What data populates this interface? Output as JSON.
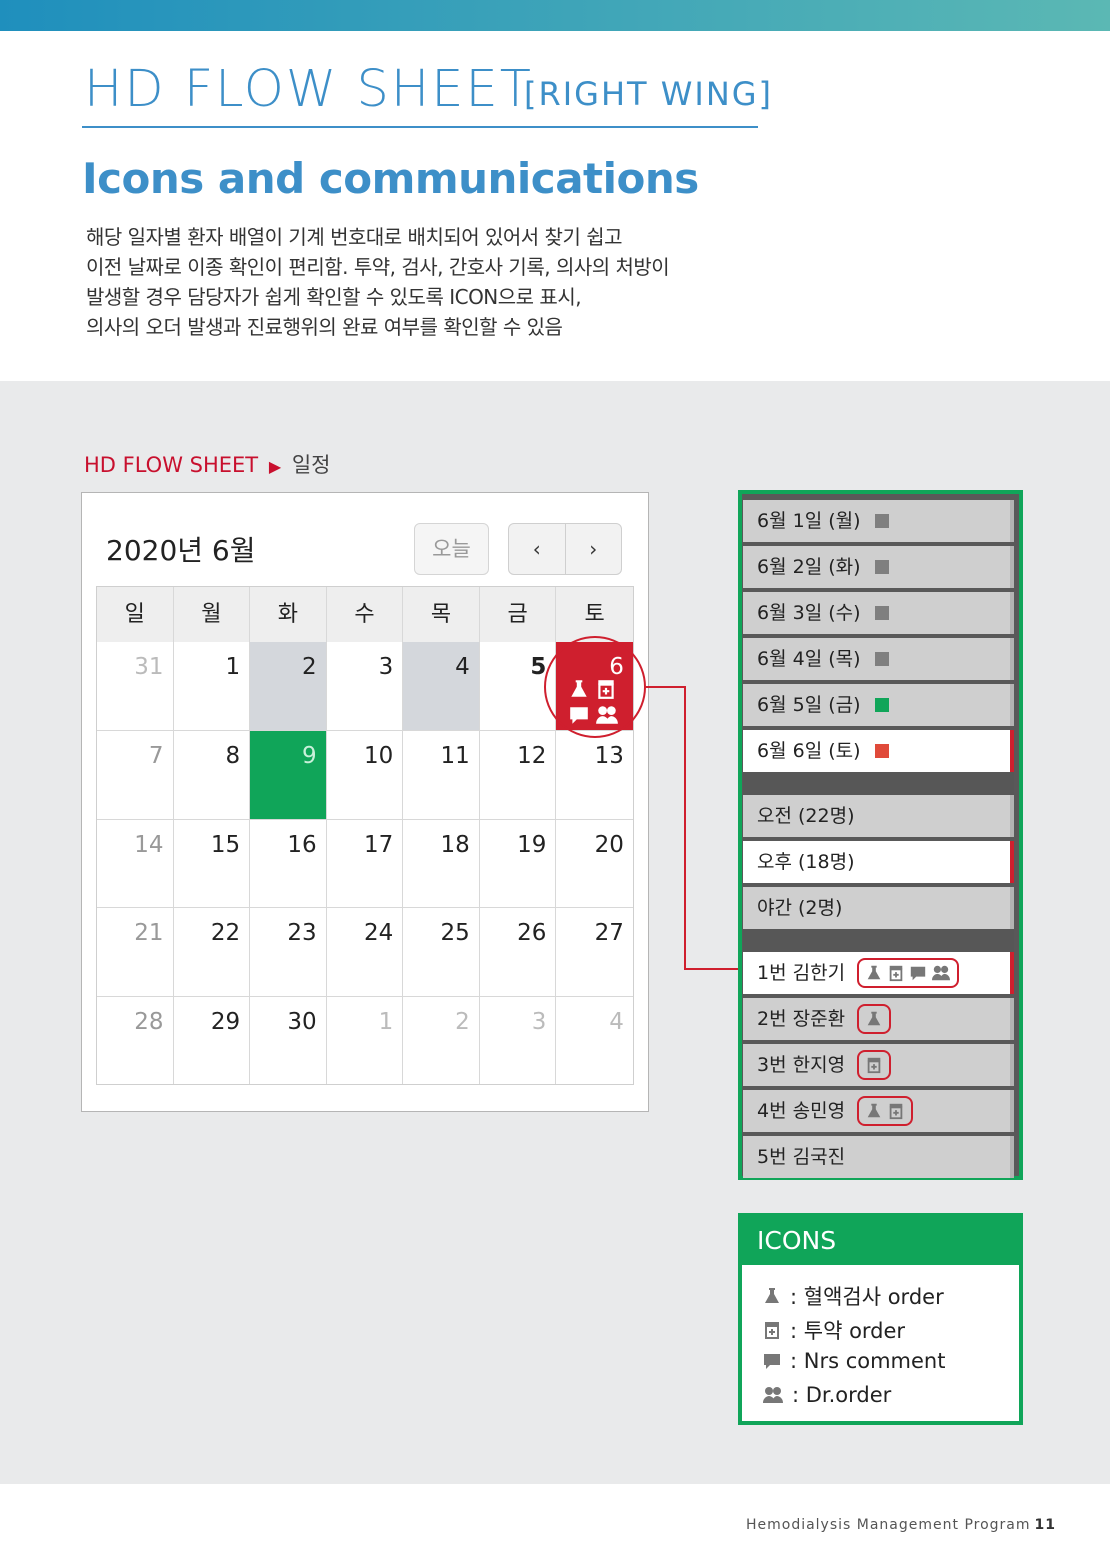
{
  "header": {
    "title_main": "HD FLOW SHEET",
    "title_sub": "[RIGHT WING]",
    "subtitle": "Icons and communications",
    "desc_lines": [
      "해당 일자별 환자 배열이 기계 번호대로 배치되어 있어서 찾기 쉽고",
      "이전 날짜로 이종 확인이 편리함. 투약, 검사, 간호사 기록, 의사의 처방이",
      "발생할 경우 담당자가 쉽게 확인할 수 있도록 ICON으로 표시,",
      "의사의 오더 발생과 진료행위의 완료 여부를 확인할 수 있음"
    ]
  },
  "section": {
    "label": "HD FLOW SHEET",
    "arrow": "▶",
    "sub": "일정"
  },
  "calendar": {
    "title": "2020년 6월",
    "today_label": "오늘",
    "prev_label": "‹",
    "next_label": "›",
    "weekdays": [
      "일",
      "월",
      "화",
      "수",
      "목",
      "금",
      "토"
    ],
    "weeks": [
      [
        "31",
        "1",
        "2",
        "3",
        "4",
        "5",
        "6"
      ],
      [
        "7",
        "8",
        "9",
        "10",
        "11",
        "12",
        "13"
      ],
      [
        "14",
        "15",
        "16",
        "17",
        "18",
        "19",
        "20"
      ],
      [
        "21",
        "22",
        "23",
        "24",
        "25",
        "26",
        "27"
      ],
      [
        "28",
        "29",
        "30",
        "1",
        "2",
        "3",
        "4"
      ]
    ]
  },
  "schedule": {
    "days": [
      {
        "label": "6월 1일 (월)",
        "color": "#7f7f7f"
      },
      {
        "label": "6월 2일 (화)",
        "color": "#7f7f7f"
      },
      {
        "label": "6월 3일 (수)",
        "color": "#7f7f7f"
      },
      {
        "label": "6월 4일 (목)",
        "color": "#7f7f7f"
      },
      {
        "label": "6월 5일 (금)",
        "color": "#10a559"
      },
      {
        "label": "6월 6일 (토)",
        "color": "#e04a3a"
      }
    ],
    "shifts": [
      "오전 (22명)",
      "오후 (18명)",
      "야간 (2명)"
    ],
    "patients": [
      "1번 김한기",
      "2번 장준환",
      "3번 한지영",
      "4번 송민영",
      "5번 김국진"
    ]
  },
  "icons_legend": {
    "title": "ICONS",
    "items": [
      {
        "icon": "flask-icon",
        "text": ": 혈액검사 order"
      },
      {
        "icon": "medicine-icon",
        "text": ": 투약 order"
      },
      {
        "icon": "comment-icon",
        "text": ": Nrs comment"
      },
      {
        "icon": "doctor-icon",
        "text": ": Dr.order"
      }
    ]
  },
  "footer": {
    "text": "Hemodialysis Management Program",
    "page": "11"
  }
}
